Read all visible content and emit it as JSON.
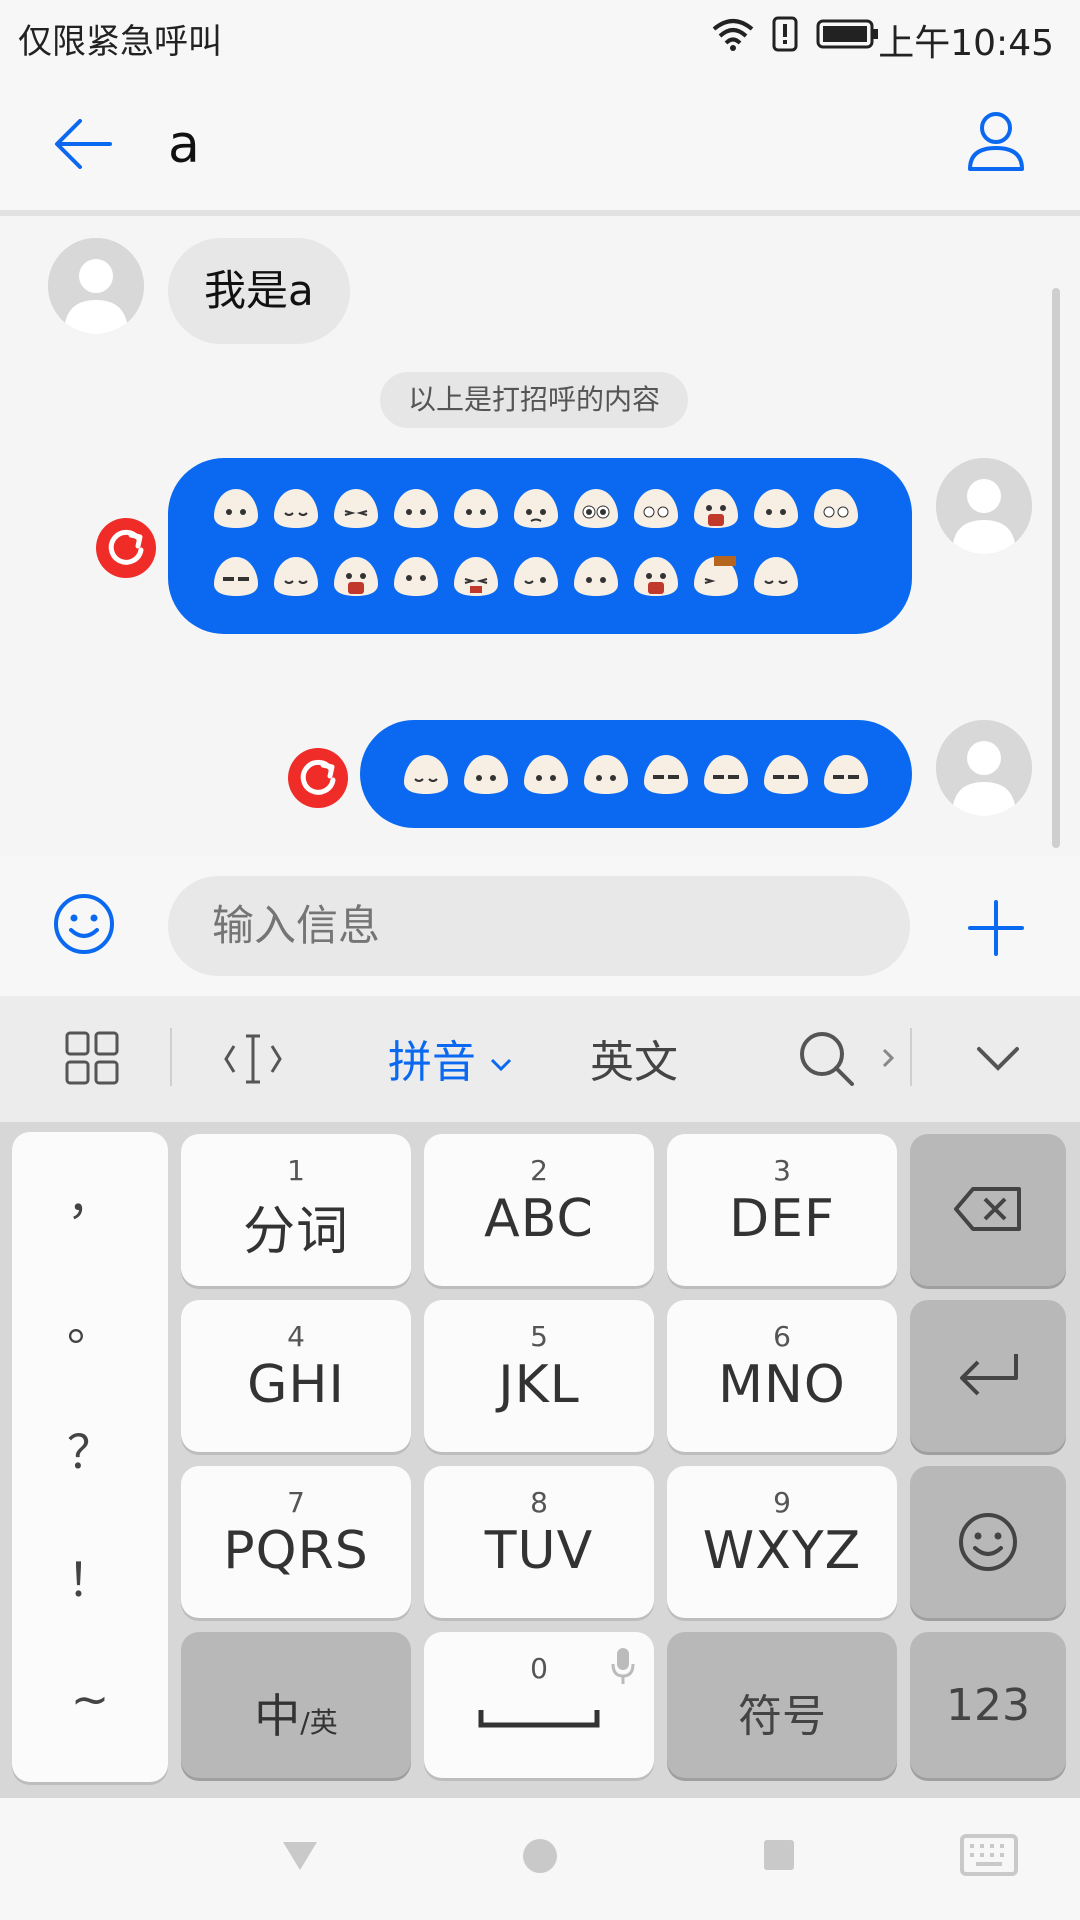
{
  "status_bar": {
    "carrier_text": "仅限紧急呼叫",
    "time": "上午10:45",
    "icons": [
      "wifi-icon",
      "alert-icon",
      "battery-icon"
    ]
  },
  "header": {
    "back_icon": "back-arrow-icon",
    "title": "a",
    "contact_icon": "person-icon"
  },
  "chat": {
    "incoming_message": "我是a",
    "system_notice": "以上是打招呼的内容",
    "retry_icon": "retry-icon"
  },
  "input_row": {
    "emoji_icon": "smiley-icon",
    "placeholder": "输入信息",
    "add_icon": "plus-icon"
  },
  "keyboard_toolbar": {
    "items": [
      "grid-icon",
      "cursor-icon",
      "拼音",
      "英文",
      "search-icon",
      "collapse-icon"
    ],
    "pinyin_label": "拼音",
    "english_label": "英文"
  },
  "keyboard": {
    "punctuation": [
      "，",
      "。",
      "？",
      "！",
      "~"
    ],
    "keys": [
      {
        "num": "1",
        "letters": "分词"
      },
      {
        "num": "2",
        "letters": "ABC"
      },
      {
        "num": "3",
        "letters": "DEF"
      },
      {
        "num": "4",
        "letters": "GHI"
      },
      {
        "num": "5",
        "letters": "JKL"
      },
      {
        "num": "6",
        "letters": "MNO"
      },
      {
        "num": "7",
        "letters": "PQRS"
      },
      {
        "num": "8",
        "letters": "TUV"
      },
      {
        "num": "9",
        "letters": "WXYZ"
      }
    ],
    "lang_switch_main": "中",
    "lang_switch_sub": "/英",
    "space_num": "0",
    "symbols_label": "符号",
    "numbers_label": "123",
    "colors": {
      "accent": "#0a69f0",
      "retry": "#ef2c28"
    }
  },
  "nav_bar": {
    "icons": [
      "back-triangle-icon",
      "home-circle-icon",
      "recents-square-icon",
      "keyboard-icon"
    ]
  }
}
